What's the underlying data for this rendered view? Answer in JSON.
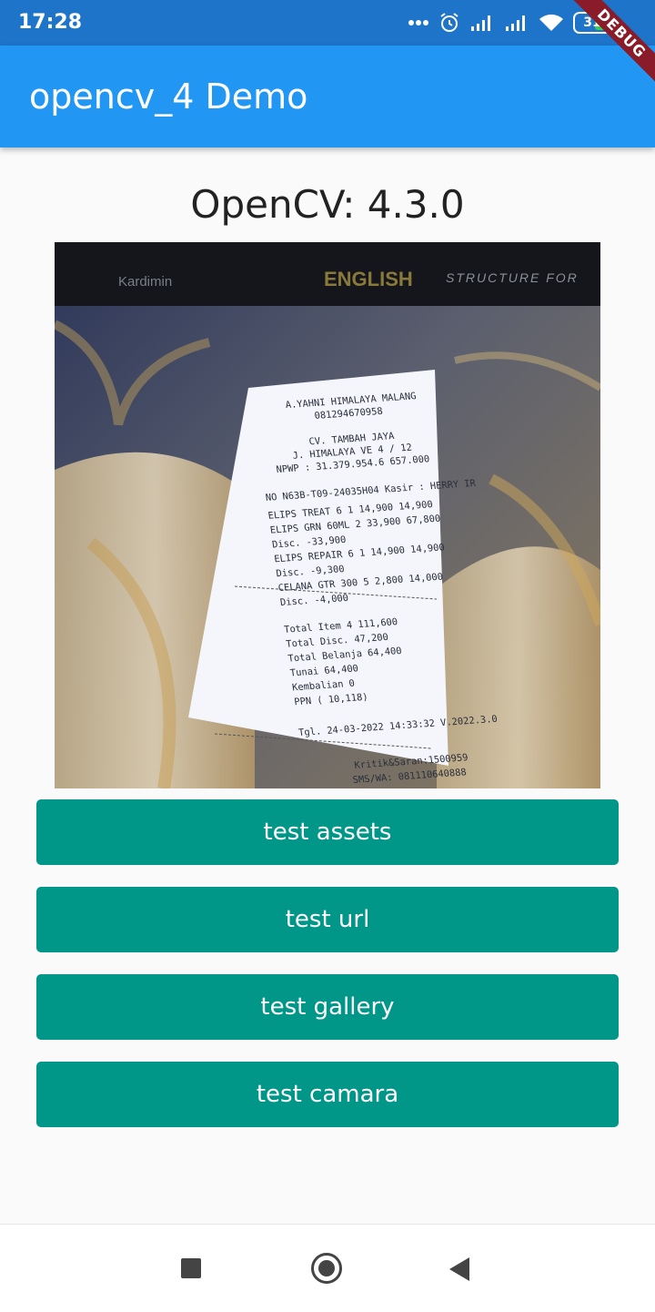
{
  "status_bar": {
    "time": "17:28",
    "battery_level": "31",
    "icons": [
      "more-dots-icon",
      "alarm-icon",
      "signal-icon",
      "signal-icon",
      "wifi-icon",
      "battery-icon"
    ]
  },
  "debug_banner": "DEBUG",
  "app_bar": {
    "title": "opencv_4 Demo"
  },
  "main": {
    "version_text": "OpenCV: 4.3.0",
    "image": {
      "book_text_left": "Kardimin",
      "book_text_mid": "ENGLISH",
      "book_text_right": "STRUCTURE FOR",
      "receipt_lines": [
        "A.YAHNI HIMALAYA MALANG",
        "081294670958",
        "CV. TAMBAH JAYA",
        "J. HIMALAYA VE 4 / 12",
        "NPWP : 31.379.954.6 657.000",
        "NO   N63B-T09-24035H04 Kasir : HERRY IR",
        "ELIPS TREAT 6      1  14,900     14,900",
        "ELIPS GRN 60ML     2  33,900     67,800",
        "Disc.   -33,900",
        "ELIPS REPAIR 6     1  14,900     14,900",
        "Disc.    -9,300",
        "CELANA GTR 300     5   2,800     14,000",
        "Disc.    -4,000",
        "Total Item     4              111,600",
        "Total Disc.                    47,200",
        "Total Belanja                  64,400",
        "Tunai                          64,400",
        "Kembalian                           0",
        "PPN (     10,118)",
        "Tgl.  24-03-2022  14:33:32  V.2022.3.0",
        "Kritik&Saran:1500959",
        "SMS/WA: 081110640888"
      ]
    }
  },
  "buttons": {
    "assets": "test assets",
    "url": "test url",
    "gallery": "test gallery",
    "camera": "test camara"
  },
  "colors": {
    "status_bar": "#1e74c8",
    "app_bar": "#2196f3",
    "button": "#009688",
    "background": "#fafafa"
  },
  "nav_bar": {
    "icons": [
      "recents-square-icon",
      "home-circle-icon",
      "back-triangle-icon"
    ]
  }
}
